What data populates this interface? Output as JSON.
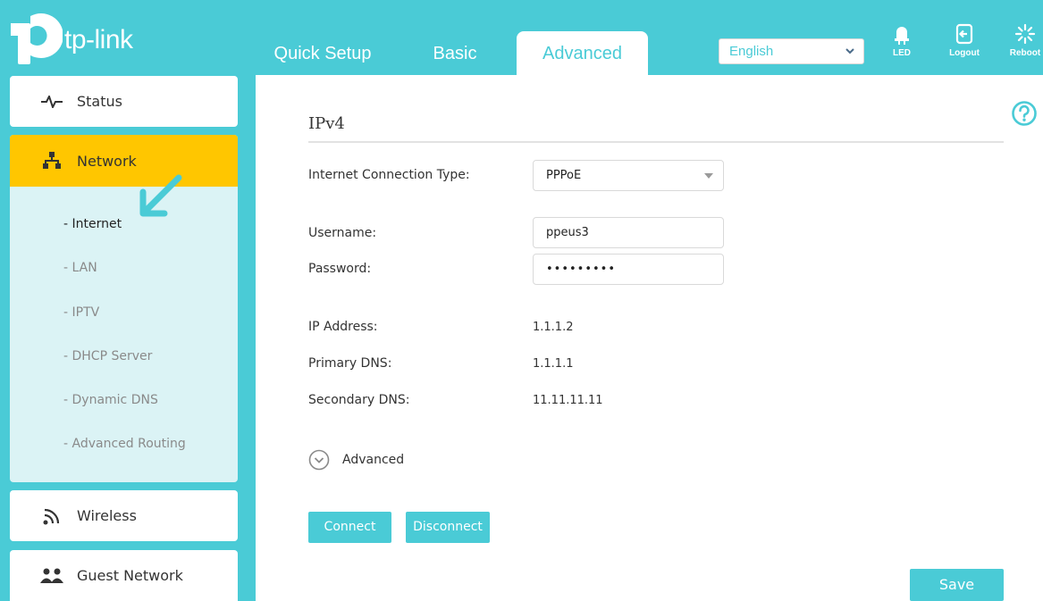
{
  "brand": {
    "name": "tp-link"
  },
  "nav_tabs": [
    {
      "label": "Quick Setup"
    },
    {
      "label": "Basic"
    },
    {
      "label": "Advanced",
      "active": true
    }
  ],
  "language": {
    "selected": "English"
  },
  "tools": {
    "led_label": "LED",
    "logout_label": "Logout",
    "reboot_label": "Reboot"
  },
  "sidebar": {
    "status_label": "Status",
    "network_label": "Network",
    "network_sub": [
      {
        "label": "- Internet",
        "active": true
      },
      {
        "label": "- LAN"
      },
      {
        "label": "- IPTV"
      },
      {
        "label": "- DHCP Server"
      },
      {
        "label": "- Dynamic DNS"
      },
      {
        "label": "- Advanced Routing"
      }
    ],
    "wireless_label": "Wireless",
    "guest_label": "Guest Network"
  },
  "main": {
    "section_title": "IPv4",
    "conn_type_label": "Internet Connection Type:",
    "conn_type_value": "PPPoE",
    "username_label": "Username:",
    "username_value": "ppeus3",
    "password_label": "Password:",
    "password_value": "•••••••••",
    "ip_label": "IP Address:",
    "ip_value": "1.1.1.2",
    "pdns_label": "Primary DNS:",
    "pdns_value": "1.1.1.1",
    "sdns_label": "Secondary DNS:",
    "sdns_value": "11.11.11.11",
    "advanced_toggle_label": "Advanced",
    "connect_label": "Connect",
    "disconnect_label": "Disconnect",
    "save_label": "Save"
  },
  "colors": {
    "brand_teal": "#4acbd6",
    "highlight_yellow": "#ffc600",
    "submenu_bg": "#dbf3f5"
  },
  "icons": [
    "help-icon",
    "led-icon",
    "logout-icon",
    "reboot-icon",
    "status-icon",
    "network-icon",
    "wireless-icon",
    "guest-network-icon",
    "arrow-pointer-icon",
    "chevron-down-icon"
  ]
}
